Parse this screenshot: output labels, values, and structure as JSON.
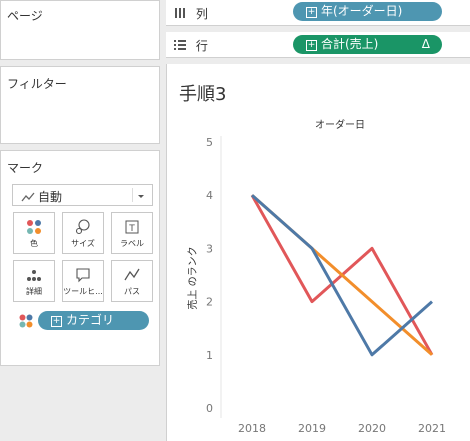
{
  "left_panel": {
    "pages_title": "ページ",
    "filters_title": "フィルター",
    "marks_title": "マーク",
    "mark_type": "自動",
    "mark_buttons": [
      {
        "label": "色",
        "icon": "color-icon"
      },
      {
        "label": "サイズ",
        "icon": "size-icon"
      },
      {
        "label": "ラベル",
        "icon": "label-icon"
      },
      {
        "label": "詳細",
        "icon": "detail-icon"
      },
      {
        "label": "ツールヒ...",
        "icon": "tooltip-icon"
      },
      {
        "label": "パス",
        "icon": "path-icon"
      }
    ],
    "color_pill": "カテゴリ"
  },
  "shelves": {
    "columns_label": "列",
    "columns_pill": "年(オーダー日)",
    "rows_label": "行",
    "rows_pill": "合計(売上)",
    "rows_pill_suffix": "Δ"
  },
  "sheet": {
    "title": "手順3"
  },
  "colors": {
    "columns_pill": "#4e96b1",
    "rows_pill": "#1a9566",
    "color_pill": "#4e96b1"
  },
  "chart_data": {
    "type": "line",
    "title": "オーダー日",
    "ylabel": "売上 のランク",
    "xlabel": "",
    "x": [
      "2018",
      "2019",
      "2020",
      "2021"
    ],
    "ylim": [
      0,
      5
    ],
    "yticks": [
      "0",
      "1",
      "2",
      "3",
      "4",
      "5"
    ],
    "series": [
      {
        "color": "#e15759",
        "values": [
          4,
          2,
          3,
          1
        ]
      },
      {
        "color": "#f28e2b",
        "values": [
          4,
          3,
          2,
          1
        ]
      },
      {
        "color": "#4e79a7",
        "values": [
          4,
          3,
          1,
          2
        ]
      }
    ]
  }
}
